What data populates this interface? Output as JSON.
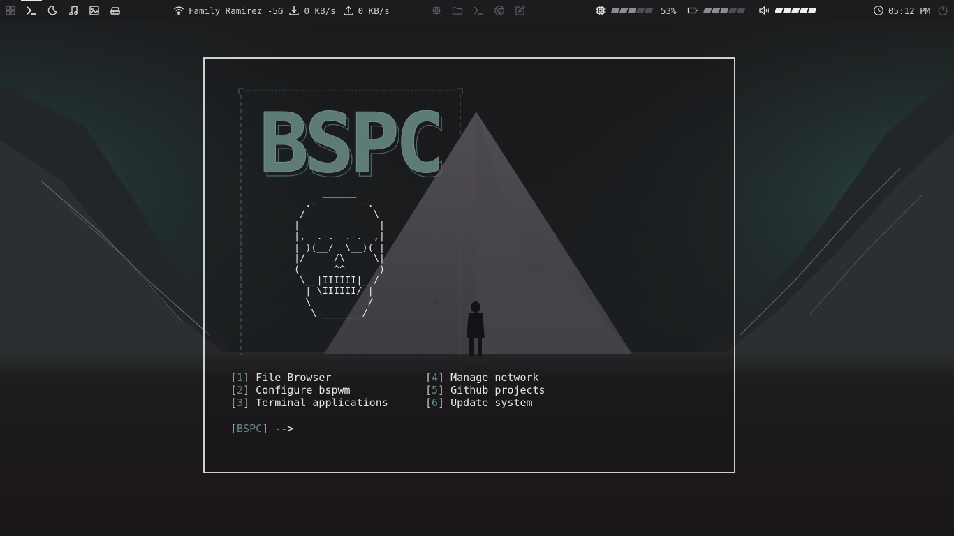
{
  "topbar": {
    "left_icons": [
      "apps-grid-icon",
      "terminal-icon",
      "moon-icon",
      "music-icon",
      "image-icon",
      "drive-icon"
    ],
    "active_workspace": 1,
    "wifi_icon": "wifi-icon",
    "network_name": "Family Ramirez -5G",
    "download_speed": "0 KB/s",
    "upload_speed": "0 KB/s",
    "center_icons": [
      "settings-icon",
      "folder-icon",
      "terminal-icon",
      "browser-icon",
      "edit-icon"
    ],
    "cpu": {
      "icon": "cpu-icon",
      "level": 0.53,
      "text": "53%"
    },
    "battery": {
      "icon": "battery-icon",
      "level": 0.5
    },
    "volume": {
      "icon": "volume-icon",
      "level": 1.0
    },
    "clock_icon": "clock-icon",
    "time": "05:12 PM",
    "power_icon": "power-icon"
  },
  "terminal": {
    "banner_text": "BSPC",
    "skull_art": "     ______\n  .-        -.\n /            \\\n|              |\n|,  .-.  .-.  ,|\n| )(__/  \\__)( |\n|/     /\\     \\|\n(_     ^^     _)\n \\__|IIIIII|__/\n  | \\IIIIII/ |\n  \\          /\n   \\ ______ /",
    "bracket_open": "[",
    "bracket_close": "]",
    "menu_left": [
      {
        "num": "1",
        "label": "File Browser"
      },
      {
        "num": "2",
        "label": "Configure bspwm"
      },
      {
        "num": "3",
        "label": "Terminal applications"
      }
    ],
    "menu_right": [
      {
        "num": "4",
        "label": "Manage network"
      },
      {
        "num": "5",
        "label": "Github projects"
      },
      {
        "num": "6",
        "label": "Update system"
      }
    ],
    "prompt_tag": "BSPC",
    "prompt_arrow": " -->"
  },
  "colors": {
    "bar_bg": "#1c1b1d",
    "accent": "#5f8a86",
    "text": "#e6e6e6",
    "banner_fill": "#5f7b78"
  }
}
